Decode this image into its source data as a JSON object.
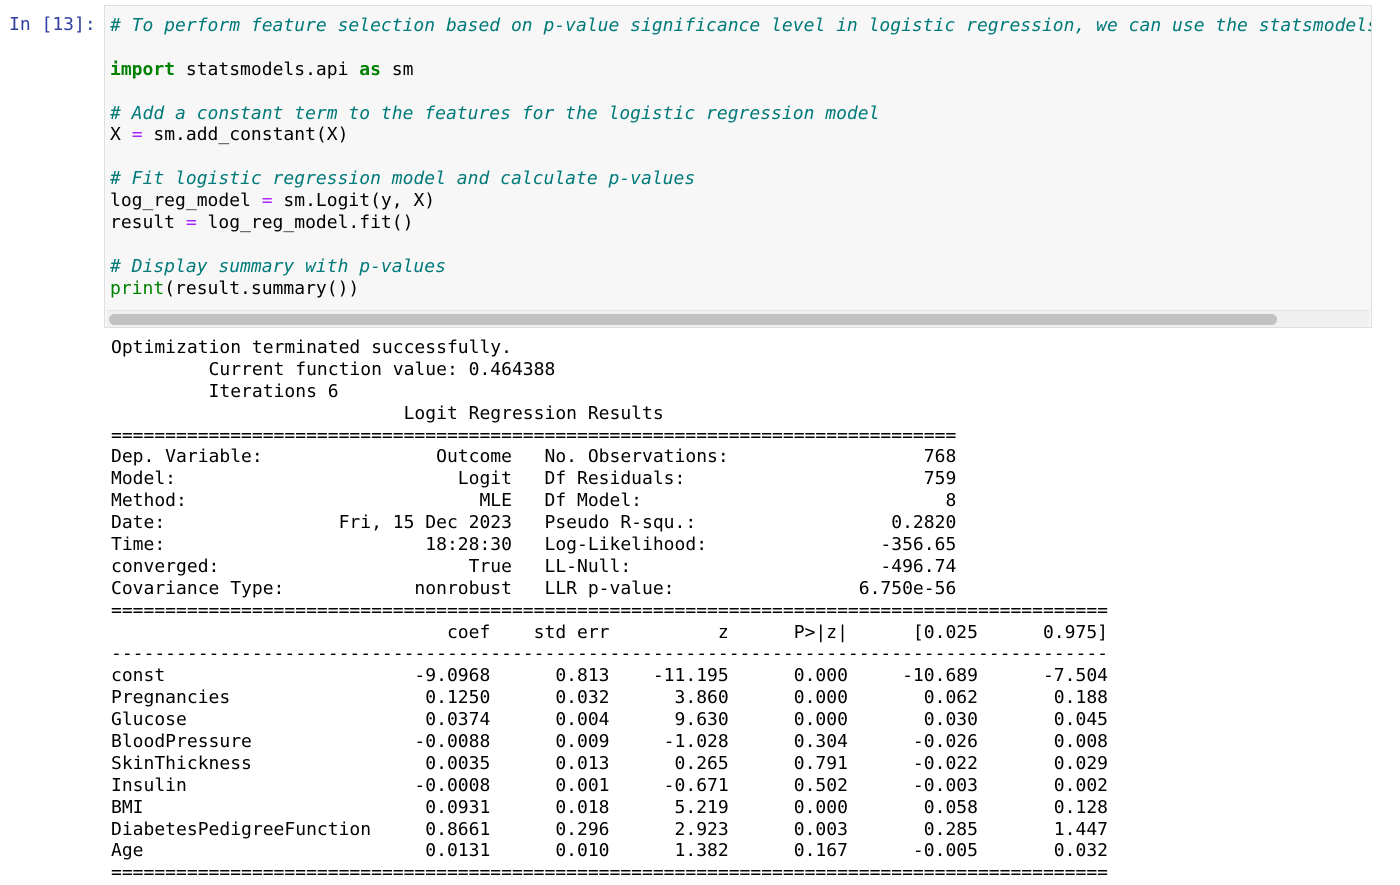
{
  "cell": {
    "prompt": "In [13]:",
    "code_lines": [
      [
        {
          "t": "c",
          "v": "# To perform feature selection based on p-value significance level in logistic regression, we can use the statsmodels.api library."
        }
      ],
      [],
      [
        {
          "t": "k",
          "v": "import"
        },
        {
          "t": "",
          "v": " statsmodels.api "
        },
        {
          "t": "k",
          "v": "as"
        },
        {
          "t": "",
          "v": " sm"
        }
      ],
      [],
      [
        {
          "t": "c",
          "v": "# Add a constant term to the features for the logistic regression model"
        }
      ],
      [
        {
          "t": "",
          "v": "X "
        },
        {
          "t": "o",
          "v": "="
        },
        {
          "t": "",
          "v": " sm.add_constant(X)"
        }
      ],
      [],
      [
        {
          "t": "c",
          "v": "# Fit logistic regression model and calculate p-values"
        }
      ],
      [
        {
          "t": "",
          "v": "log_reg_model "
        },
        {
          "t": "o",
          "v": "="
        },
        {
          "t": "",
          "v": " sm.Logit(y, X)"
        }
      ],
      [
        {
          "t": "",
          "v": "result "
        },
        {
          "t": "o",
          "v": "="
        },
        {
          "t": "",
          "v": " log_reg_model.fit()"
        }
      ],
      [],
      [
        {
          "t": "c",
          "v": "# Display summary with p-values"
        }
      ],
      [
        {
          "t": "b",
          "v": "print"
        },
        {
          "t": "",
          "v": "(result.summary())"
        }
      ]
    ]
  },
  "output": {
    "lines": [
      "Optimization terminated successfully.",
      "         Current function value: 0.464388",
      "         Iterations 6",
      "                           Logit Regression Results                           ",
      "==============================================================================",
      "Dep. Variable:                Outcome   No. Observations:                  768",
      "Model:                          Logit   Df Residuals:                      759",
      "Method:                           MLE   Df Model:                            8",
      "Date:                Fri, 15 Dec 2023   Pseudo R-squ.:                  0.2820",
      "Time:                        18:28:30   Log-Likelihood:                -356.65",
      "converged:                       True   LL-Null:                       -496.74",
      "Covariance Type:            nonrobust   LLR p-value:                 6.750e-56",
      "============================================================================================",
      "                               coef    std err          z      P>|z|      [0.025      0.975]",
      "--------------------------------------------------------------------------------------------",
      "const                       -9.0968      0.813    -11.195      0.000     -10.689      -7.504",
      "Pregnancies                  0.1250      0.032      3.860      0.000       0.062       0.188",
      "Glucose                      0.0374      0.004      9.630      0.000       0.030       0.045",
      "BloodPressure               -0.0088      0.009     -1.028      0.304      -0.026       0.008",
      "SkinThickness                0.0035      0.013      0.265      0.791      -0.022       0.029",
      "Insulin                     -0.0008      0.001     -0.671      0.502      -0.003       0.002",
      "BMI                          0.0931      0.018      5.219      0.000       0.058       0.128",
      "DiabetesPedigreeFunction     0.8661      0.296      2.923      0.003       0.285       1.447",
      "Age                          0.0131      0.010      1.382      0.167      -0.005       0.032",
      "============================================================================================"
    ]
  }
}
